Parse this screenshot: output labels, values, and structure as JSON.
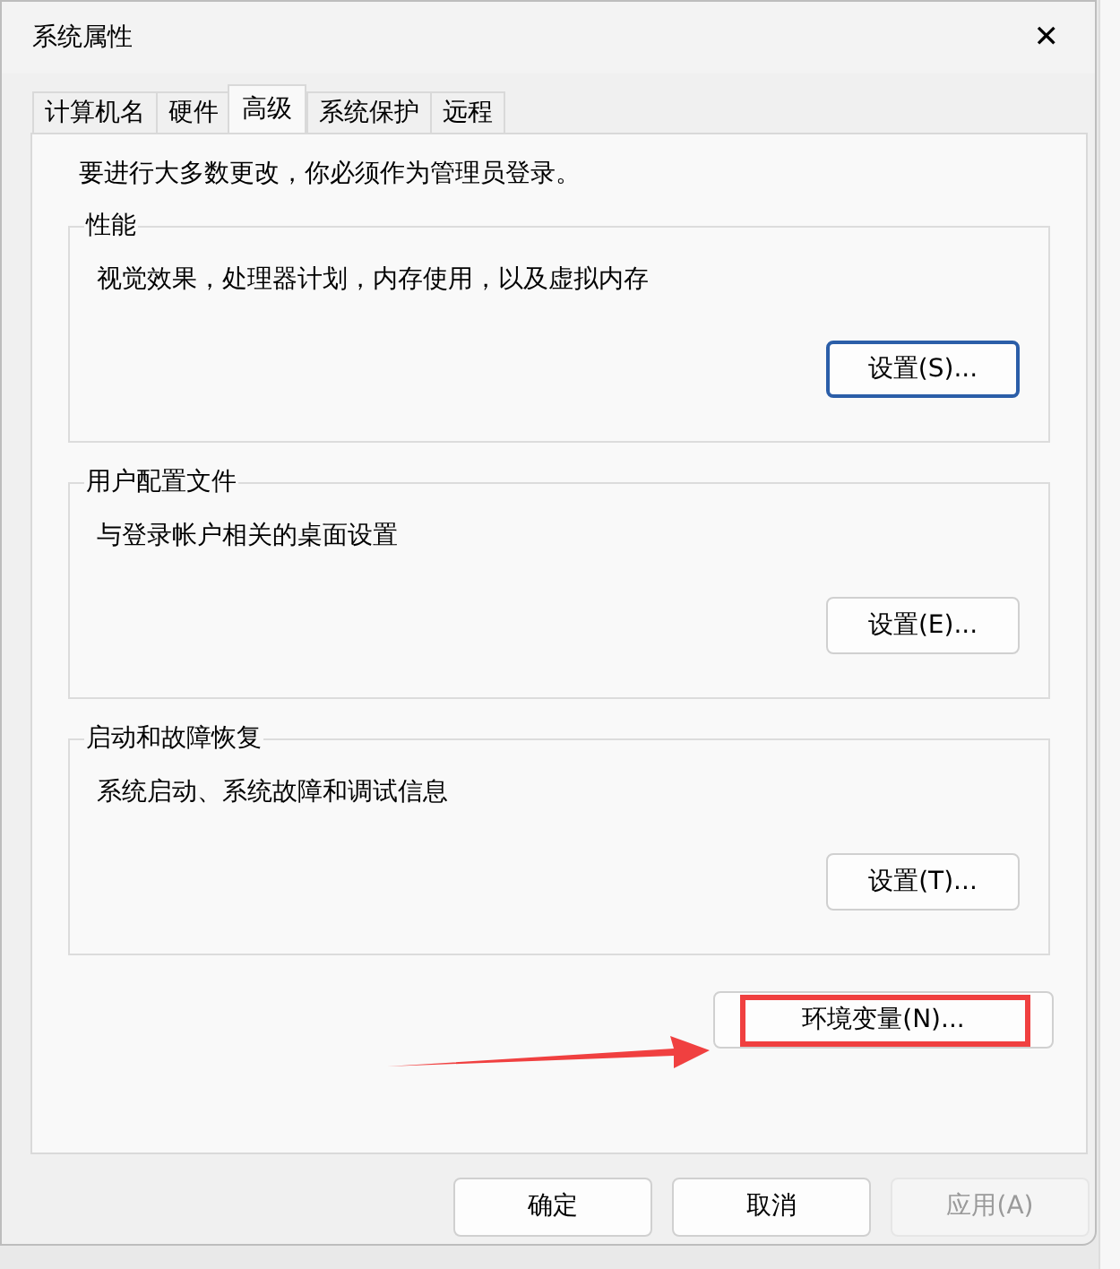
{
  "window": {
    "title": "系统属性",
    "close": "✕"
  },
  "tabs": [
    {
      "label": "计算机名",
      "selected": false
    },
    {
      "label": "硬件",
      "selected": false
    },
    {
      "label": "高级",
      "selected": true
    },
    {
      "label": "系统保护",
      "selected": false
    },
    {
      "label": "远程",
      "selected": false
    }
  ],
  "notice": "要进行大多数更改，你必须作为管理员登录。",
  "groups": [
    {
      "title": "性能",
      "description": "视觉效果，处理器计划，内存使用，以及虚拟内存",
      "button": "设置(S)...",
      "focused": true
    },
    {
      "title": "用户配置文件",
      "description": "与登录帐户相关的桌面设置",
      "button": "设置(E)...",
      "focused": false
    },
    {
      "title": "启动和故障恢复",
      "description": "系统启动、系统故障和调试信息",
      "button": "设置(T)...",
      "focused": false
    }
  ],
  "env_button": {
    "label": "环境变量(N)...",
    "highlighted": true
  },
  "buttons": [
    {
      "label": "确定",
      "disabled": false
    },
    {
      "label": "取消",
      "disabled": false
    },
    {
      "label": "应用(A)",
      "disabled": true
    }
  ]
}
